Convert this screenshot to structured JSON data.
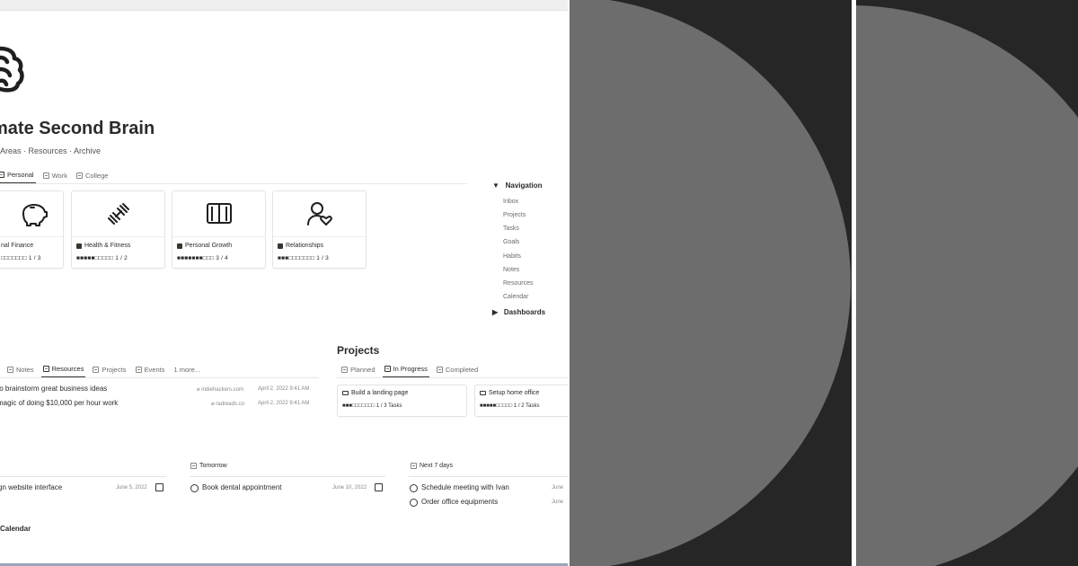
{
  "page": {
    "title": "mate Second Brain",
    "breadcrumb": "- Areas · Resources · Archive"
  },
  "area_tabs": [
    {
      "label": "Personal",
      "active": true
    },
    {
      "label": "Work",
      "active": false
    },
    {
      "label": "College",
      "active": false
    }
  ],
  "area_cards": [
    {
      "icon": "piggy-bank-icon",
      "title": "nal Finance",
      "progress_text": "□□□□□□□ 1 / 3",
      "progress": 0.33
    },
    {
      "icon": "dumbbell-icon",
      "title": "Health & Fitness",
      "progress_text": "■■■■■□□□□□ 1 / 2",
      "progress": 0.5
    },
    {
      "icon": "book-icon",
      "title": "Personal Growth",
      "progress_text": "■■■■■■■□□□ 3 / 4",
      "progress": 0.75
    },
    {
      "icon": "person-heart-icon",
      "title": "Relationships",
      "progress_text": "■■■□□□□□□□ 1 / 3",
      "progress": 0.33
    }
  ],
  "navigation": {
    "title": "Navigation",
    "items": [
      "Inbox",
      "Projects",
      "Tasks",
      "Goals",
      "Habits",
      "Notes",
      "Resources",
      "Calendar"
    ],
    "dashboards": "Dashboards"
  },
  "resource_tabs": [
    {
      "label": "Notes",
      "active": false
    },
    {
      "label": "Resources",
      "active": true
    },
    {
      "label": "Projects",
      "active": false
    },
    {
      "label": "Events",
      "active": false
    },
    {
      "label": "1 more...",
      "active": false
    }
  ],
  "resources": [
    {
      "title": "to brainstorm great business ideas",
      "source": "indiehackers.com",
      "date": "April 2, 2022 9:41 AM"
    },
    {
      "title": "magic of doing $10,000 per hour work",
      "source": "radreads.co",
      "date": "April 2, 2022 9:41 AM"
    }
  ],
  "projects": {
    "title": "Projects",
    "tabs": [
      {
        "label": "Planned",
        "active": false
      },
      {
        "label": "In Progress",
        "active": true
      },
      {
        "label": "Completed",
        "active": false
      }
    ],
    "cards": [
      {
        "name": "Build a landing page",
        "progress_text": "■■■□□□□□□□ 1 / 3 Tasks",
        "progress": 0.33
      },
      {
        "name": "Setup home office",
        "progress_text": "■■■■■□□□□□ 1 / 2 Tasks",
        "progress": 0.5
      }
    ]
  },
  "tasks": {
    "today": {
      "label": "",
      "items": [
        {
          "text": "gn website interface",
          "date": "June 5, 2022"
        }
      ]
    },
    "tomorrow": {
      "label": "Tomorrow",
      "items": [
        {
          "text": "Book dental appointment",
          "date": "June 10, 2022"
        }
      ]
    },
    "next7": {
      "label": "Next 7 days",
      "items": [
        {
          "text": "Schedule meeting with Ivan",
          "date": "June"
        },
        {
          "text": "Order office equipments",
          "date": "June"
        }
      ]
    }
  },
  "calendar": {
    "title": "Calendar"
  },
  "colors": {
    "panel_bg": "#262626",
    "disc": "#6d6d6d",
    "text": "#37352f"
  }
}
